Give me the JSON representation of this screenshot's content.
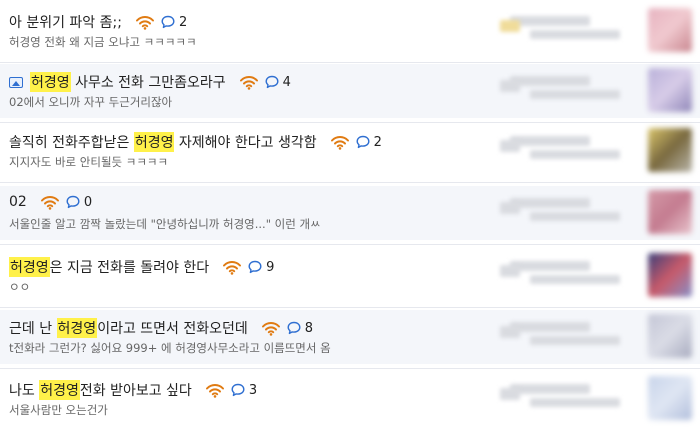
{
  "posts": [
    {
      "has_image_icon": false,
      "title": [
        {
          "t": "아 분위기 파악 좀;;",
          "hl": false
        }
      ],
      "comments": "2",
      "preview": "허경영 전화 왜 지금 오냐고 ㅋㅋㅋㅋㅋ",
      "thumb_colors": [
        "#e7b3c0",
        "#f0c9cf",
        "#c9868f"
      ]
    },
    {
      "has_image_icon": true,
      "title": [
        {
          "t": "허경영",
          "hl": true
        },
        {
          "t": " 사무소 전화 그만좀오라구",
          "hl": false
        }
      ],
      "comments": "4",
      "preview": "02에서 오니까 자꾸 두근거리잖아",
      "thumb_colors": [
        "#b9b0d9",
        "#d7cce8",
        "#8f86b8"
      ]
    },
    {
      "has_image_icon": false,
      "title": [
        {
          "t": "솔직히 전화주합낟은 ",
          "hl": false
        },
        {
          "t": "허경영",
          "hl": true
        },
        {
          "t": " 자제해야 한다고 생각함",
          "hl": false
        }
      ],
      "comments": "2",
      "preview": "지지자도 바로 안티될듯 ㅋㅋㅋㅋ",
      "thumb_colors": [
        "#d9c46a",
        "#7a6a40",
        "#b8b4a8"
      ]
    },
    {
      "has_image_icon": false,
      "title": [
        {
          "t": "02",
          "hl": false
        }
      ],
      "comments": "0",
      "preview": "서울인줄 알고 깜짝 놀랐는데 \"안녕하십니까 허경영...\" 이런 개ㅆ",
      "thumb_colors": [
        "#d49aa8",
        "#c47c90",
        "#e8c4cd"
      ]
    },
    {
      "has_image_icon": false,
      "title": [
        {
          "t": "허경영",
          "hl": true
        },
        {
          "t": "은 지금 전화를 돌려야 한다",
          "hl": false
        }
      ],
      "comments": "9",
      "preview": "ㅇㅇ",
      "thumb_colors": [
        "#3a3f7a",
        "#c75a6a",
        "#8890c8"
      ]
    },
    {
      "has_image_icon": false,
      "title": [
        {
          "t": "근데 난 ",
          "hl": false
        },
        {
          "t": "허경영",
          "hl": true
        },
        {
          "t": "이라고 뜨면서 전화오던데",
          "hl": false
        }
      ],
      "comments": "8",
      "preview": "t전화라 그런가? 싫어요 999+ 에 허경영사무소라고 이름뜨면서 옴",
      "thumb_colors": [
        "#c4c6d6",
        "#dadce6",
        "#a8abbf"
      ]
    },
    {
      "has_image_icon": false,
      "title": [
        {
          "t": "나도 ",
          "hl": false
        },
        {
          "t": "허경영",
          "hl": true
        },
        {
          "t": "전화 받아보고 싶다",
          "hl": false
        }
      ],
      "comments": "3",
      "preview": "서울사람만 오는건가",
      "thumb_colors": [
        "#c8d4ea",
        "#dfe6f3",
        "#b2bfdc"
      ]
    }
  ],
  "colors": {
    "highlight": "#fff14a",
    "wifi": "#e07b12",
    "comment_icon": "#2f6fd1",
    "image_icon": "#2f6fd1"
  },
  "icons": {
    "image": "image-icon",
    "wifi": "wifi-icon",
    "comment": "comment-bubble-icon"
  }
}
